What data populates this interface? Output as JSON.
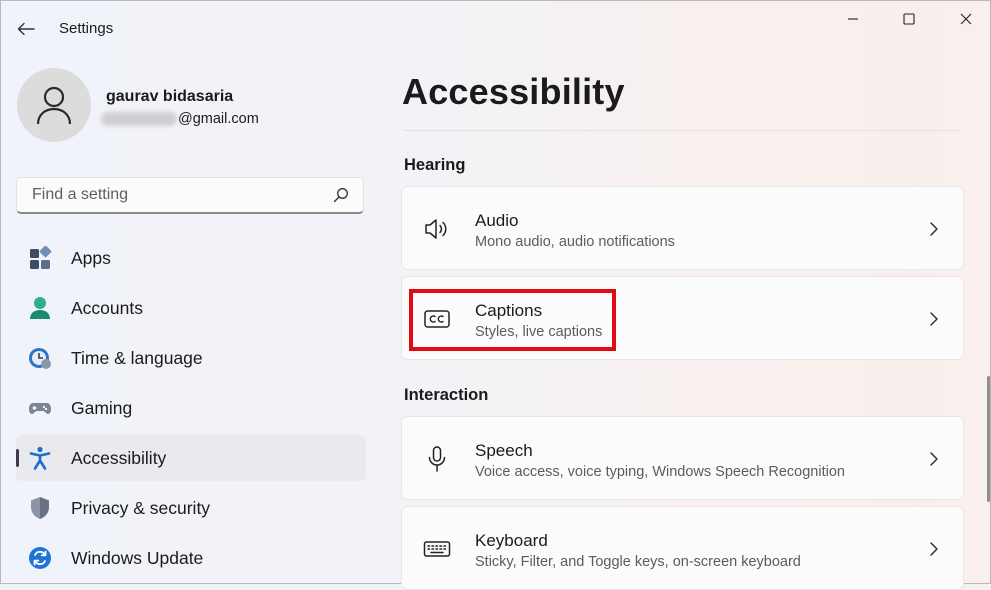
{
  "window": {
    "title": "Settings"
  },
  "user": {
    "name": "gaurav bidasaria",
    "email_suffix": "@gmail.com"
  },
  "search": {
    "placeholder": "Find a setting"
  },
  "sidebar": {
    "items": [
      {
        "label": "Apps",
        "icon": "apps-icon",
        "active": false
      },
      {
        "label": "Accounts",
        "icon": "accounts-icon",
        "active": false
      },
      {
        "label": "Time & language",
        "icon": "time-language-icon",
        "active": false
      },
      {
        "label": "Gaming",
        "icon": "gaming-icon",
        "active": false
      },
      {
        "label": "Accessibility",
        "icon": "accessibility-icon",
        "active": true
      },
      {
        "label": "Privacy & security",
        "icon": "shield-icon",
        "active": false
      },
      {
        "label": "Windows Update",
        "icon": "windows-update-icon",
        "active": false
      }
    ]
  },
  "main": {
    "title": "Accessibility",
    "sections": [
      {
        "header": "Hearing",
        "cards": [
          {
            "title": "Audio",
            "subtitle": "Mono audio, audio notifications",
            "icon": "speaker-icon"
          },
          {
            "title": "Captions",
            "subtitle": "Styles, live captions",
            "icon": "captions-icon",
            "highlighted": true
          }
        ]
      },
      {
        "header": "Interaction",
        "cards": [
          {
            "title": "Speech",
            "subtitle": "Voice access, voice typing, Windows Speech Recognition",
            "icon": "microphone-icon"
          },
          {
            "title": "Keyboard",
            "subtitle": "Sticky, Filter, and Toggle keys, on-screen keyboard",
            "icon": "keyboard-icon"
          }
        ]
      }
    ]
  },
  "colors": {
    "accent": "#0067c0",
    "highlight_box": "#e00b14"
  }
}
